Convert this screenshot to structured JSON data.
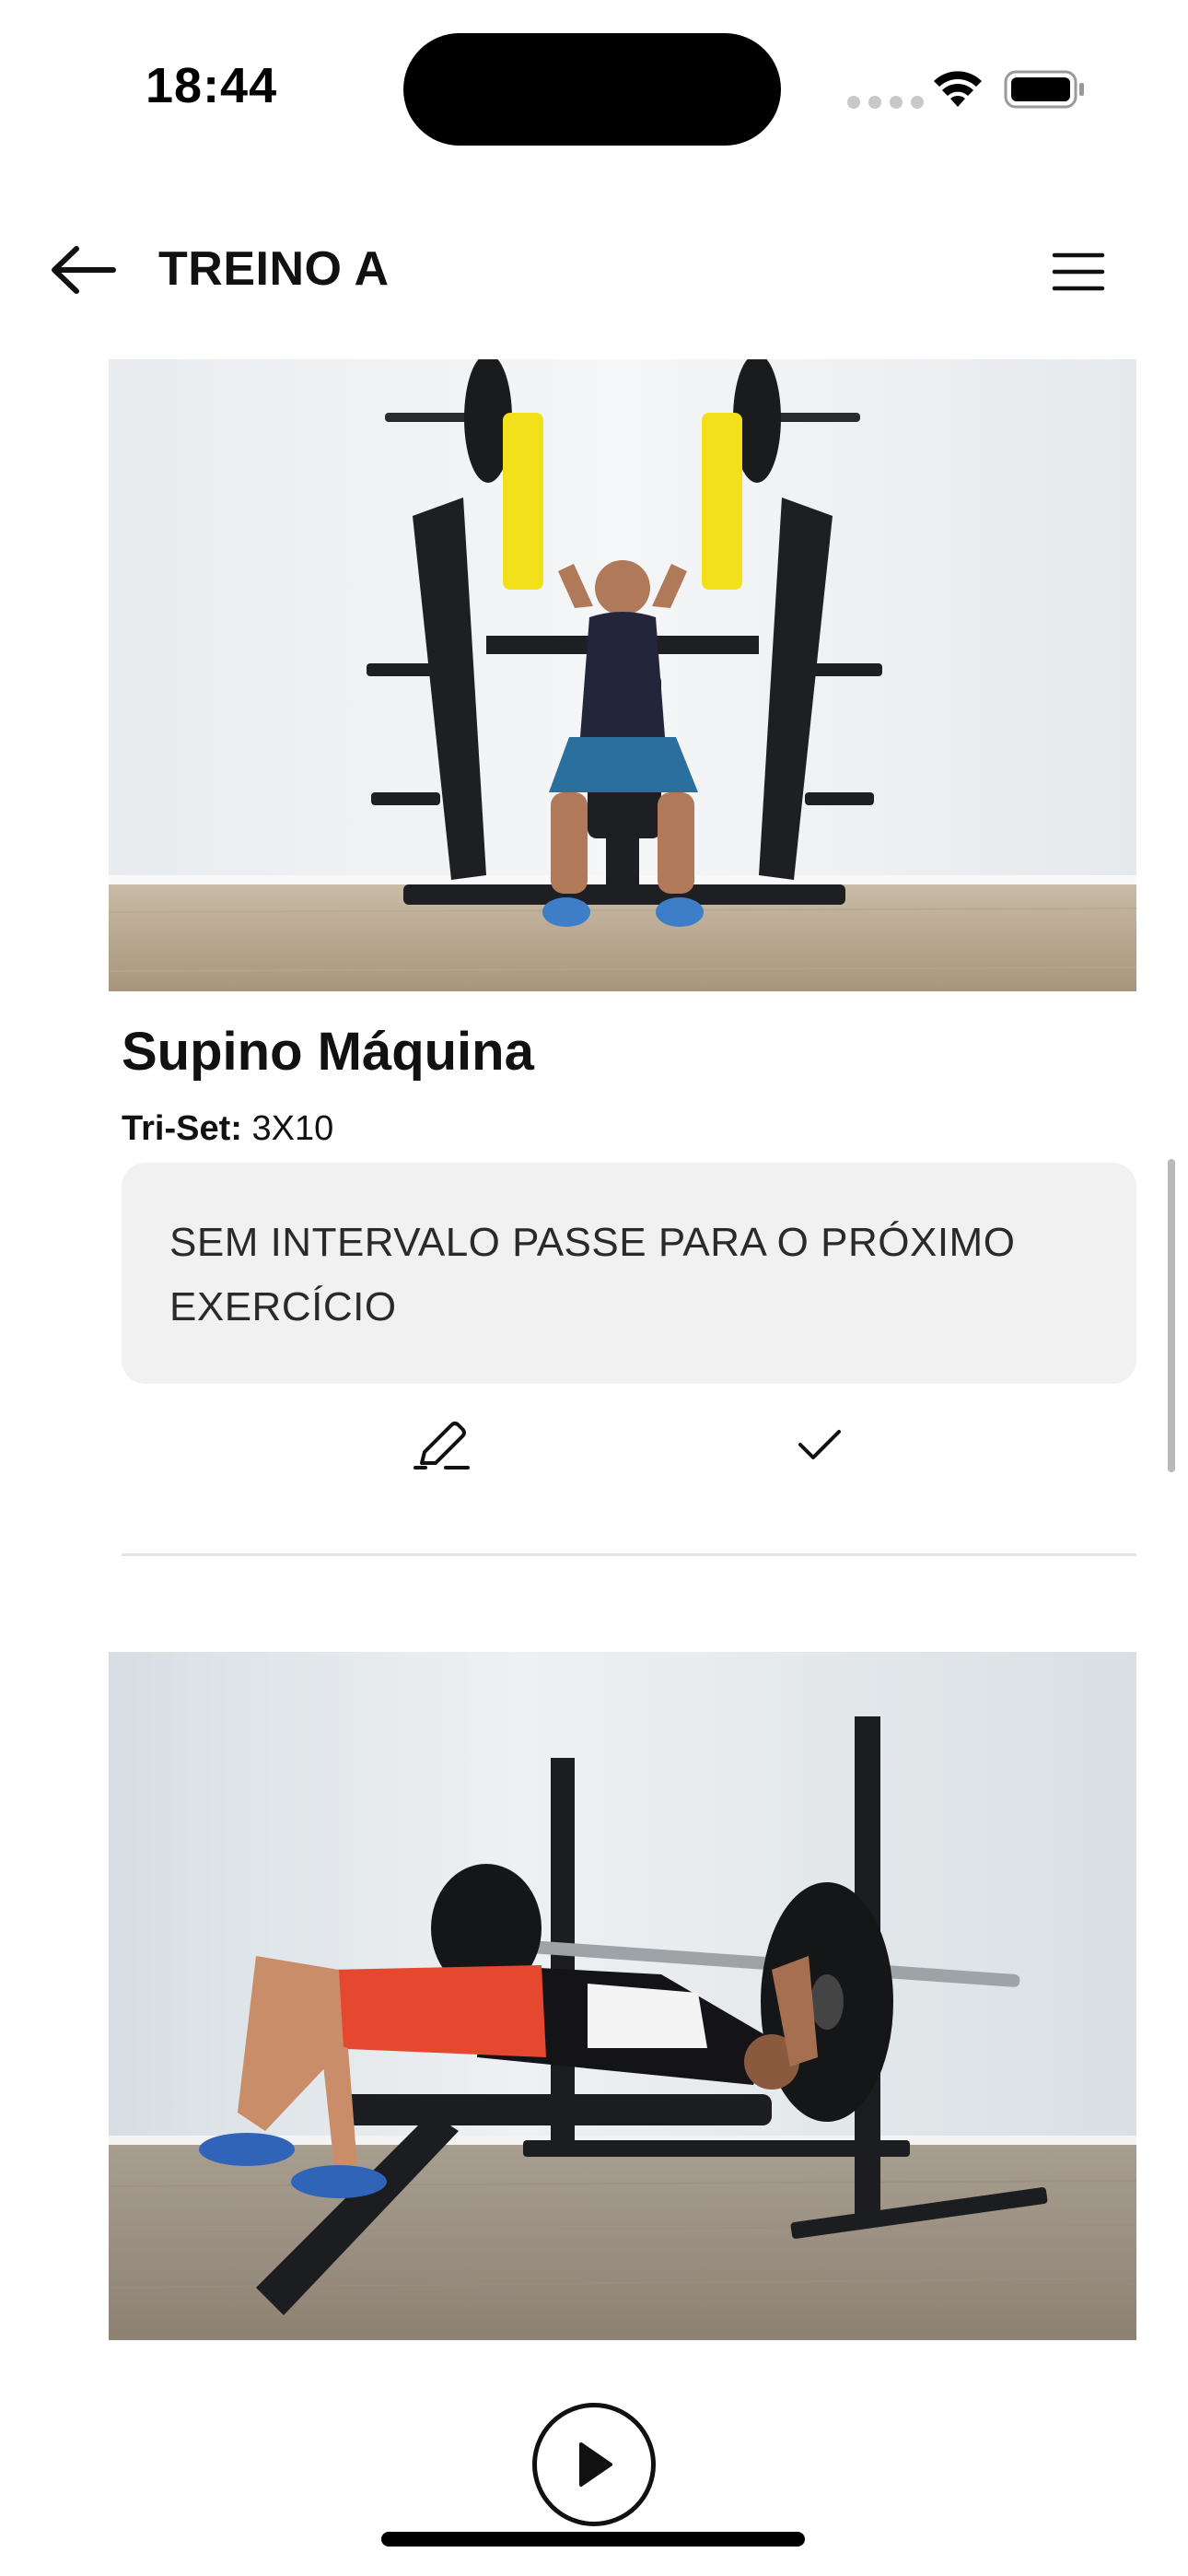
{
  "status_bar": {
    "time": "18:44"
  },
  "header": {
    "title": "TREINO A",
    "back_icon": "arrow-left-icon",
    "menu_icon": "hamburger-menu-icon"
  },
  "exercises": [
    {
      "name": "Supino Máquina",
      "sets_label": "Tri-Set:",
      "sets_value": "3X10",
      "note": "SEM INTERVALO PASSE PARA O PRÓXIMO EXERCÍCIO",
      "actions": [
        "pencil-icon",
        "check-icon"
      ]
    }
  ],
  "footer": {
    "play_icon": "play-icon"
  },
  "colors": {
    "background": "#ffffff",
    "text": "#111111",
    "note_background": "#f1f1f1",
    "machine_accent": "#f2e01a"
  }
}
